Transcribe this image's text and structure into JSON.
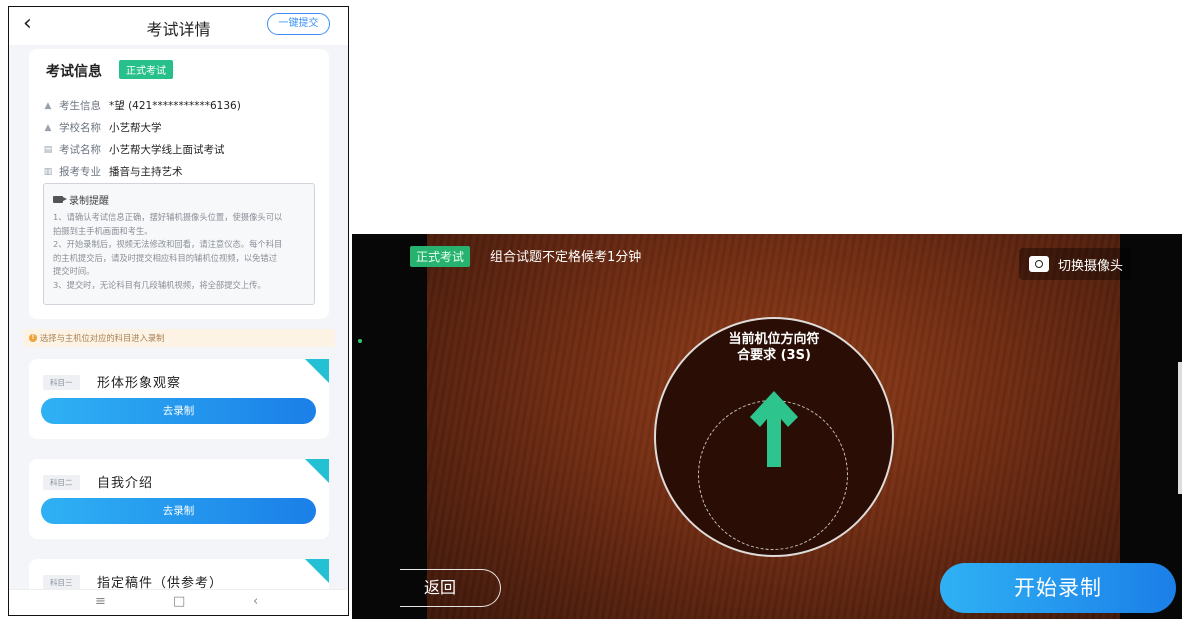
{
  "phone": {
    "title": "考试详情",
    "back_icon": "chevron-left-icon",
    "submit_all": "一键提交",
    "info": {
      "heading": "考试信息",
      "badge": "正式考试",
      "rows": [
        {
          "label": "考生信息",
          "value": "*望 (421***********6136)",
          "icon": "person-icon"
        },
        {
          "label": "学校名称",
          "value": "小艺帮大学",
          "icon": "school-icon"
        },
        {
          "label": "考试名称",
          "value": "小艺帮大学线上面试考试",
          "icon": "exam-icon"
        },
        {
          "label": "报考专业",
          "value": "播音与主持艺术",
          "icon": "major-icon"
        }
      ],
      "reminder_title": "录制提醒",
      "reminder_lines": [
        "1、请确认考试信息正确，摆好辅机摄像头位置，使摄像头可以",
        "拍摄到主手机画面和考生。",
        "2、开始录制后，视频无法修改和回看，请注意仪态。每个科目",
        "的主机提交后，请及时提交相应科目的辅机位视频，以免错过",
        "提交时间。",
        "3、提交时，无论科目有几段辅机视频，将全部提交上传。"
      ]
    },
    "tip": "选择与主机位对应的科目进入录制",
    "subjects": [
      {
        "no": "科目一",
        "name": "形体形象观察",
        "button": "去录制"
      },
      {
        "no": "科目二",
        "name": "自我介绍",
        "button": "去录制"
      },
      {
        "no": "科目三",
        "name": "指定稿件（供参考）",
        "button": ""
      }
    ],
    "nav": {
      "menu": "≡",
      "home": "□",
      "back": "‹"
    }
  },
  "camera": {
    "badge": "正式考试",
    "message": "组合试题不定格候考1分钟",
    "switch_label": "切换摄像头",
    "status_line1": "当前机位方向符",
    "status_line2": "合要求 (3S)",
    "back_label": "返回",
    "start_label": "开始录制"
  },
  "colors": {
    "accent_blue": "#1b7fe8",
    "green": "#27c08a",
    "arrow_green": "#2ec48e"
  }
}
